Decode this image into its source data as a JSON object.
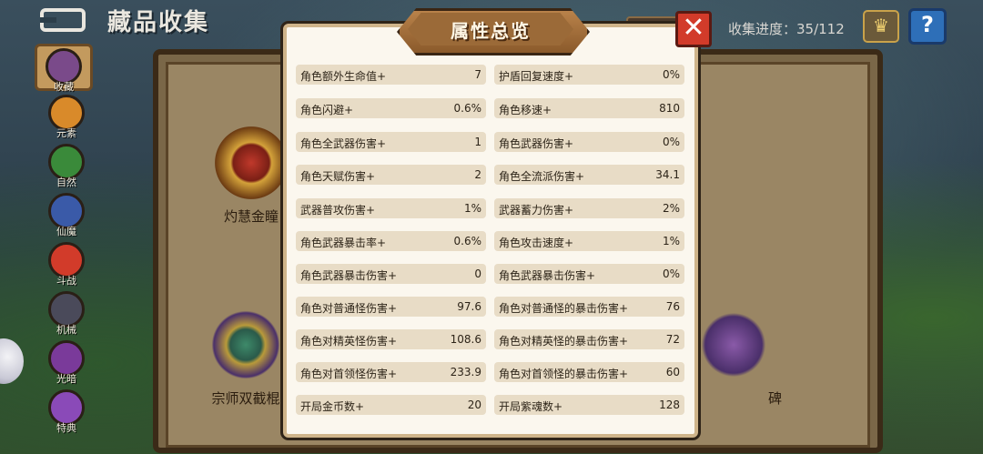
{
  "header": {
    "title": "藏品收集",
    "progress_label": "收集进度：35/112",
    "help_label": "?"
  },
  "sidebar": {
    "items": [
      {
        "label": "收藏",
        "color": "#7a4a8a"
      },
      {
        "label": "元素",
        "color": "#d98a2a"
      },
      {
        "label": "自然",
        "color": "#3a8a3a"
      },
      {
        "label": "仙魔",
        "color": "#3a5aa8"
      },
      {
        "label": "斗战",
        "color": "#d23b2a"
      },
      {
        "label": "机械",
        "color": "#4a4a5a"
      },
      {
        "label": "光暗",
        "color": "#7a3a9a"
      },
      {
        "label": "特典",
        "color": "#8a4ab8"
      }
    ]
  },
  "collection": {
    "items": [
      {
        "name": "灼慧金瞳"
      },
      {
        "name": "宗师双截棍"
      },
      {
        "name": "碑"
      }
    ]
  },
  "modal": {
    "title": "属性总览",
    "close_label": "✕",
    "stats": [
      {
        "label": "角色额外生命值+",
        "value": "7"
      },
      {
        "label": "护盾回复速度+",
        "value": "0%"
      },
      {
        "label": "角色闪避+",
        "value": "0.6%"
      },
      {
        "label": "角色移速+",
        "value": "810"
      },
      {
        "label": "角色全武器伤害+",
        "value": "1"
      },
      {
        "label": "角色武器伤害+",
        "value": "0%"
      },
      {
        "label": "角色天赋伤害+",
        "value": "2"
      },
      {
        "label": "角色全流派伤害+",
        "value": "34.1"
      },
      {
        "label": "武器普攻伤害+",
        "value": "1%"
      },
      {
        "label": "武器蓄力伤害+",
        "value": "2%"
      },
      {
        "label": "角色武器暴击率+",
        "value": "0.6%"
      },
      {
        "label": "角色攻击速度+",
        "value": "1%"
      },
      {
        "label": "角色武器暴击伤害+",
        "value": "0"
      },
      {
        "label": "角色武器暴击伤害+",
        "value": "0%"
      },
      {
        "label": "角色对普通怪伤害+",
        "value": "97.6"
      },
      {
        "label": "角色对普通怪的暴击伤害+",
        "value": "76"
      },
      {
        "label": "角色对精英怪伤害+",
        "value": "108.6"
      },
      {
        "label": "角色对精英怪的暴击伤害+",
        "value": "72"
      },
      {
        "label": "角色对首领怪伤害+",
        "value": "233.9"
      },
      {
        "label": "角色对首领怪的暴击伤害+",
        "value": "60"
      },
      {
        "label": "开局金币数+",
        "value": "20"
      },
      {
        "label": "开局紫魂数+",
        "value": "128"
      }
    ]
  }
}
